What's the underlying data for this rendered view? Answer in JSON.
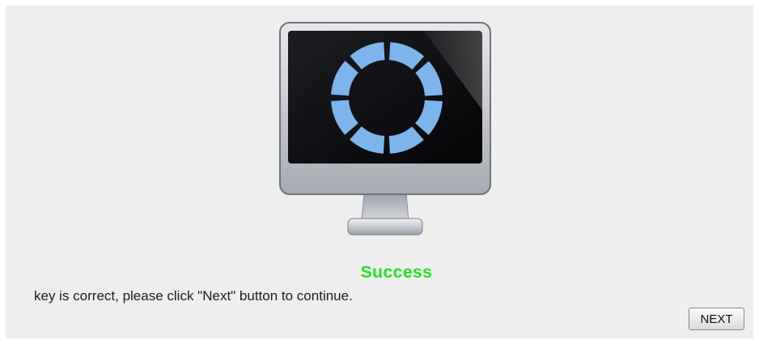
{
  "status": {
    "title": "Success",
    "message": "key is correct, please click \"Next\" button to continue."
  },
  "actions": {
    "next_label": "NEXT"
  },
  "illustration": {
    "icon": "monitor-loading-icon",
    "ring_color": "#7cb4ec"
  },
  "colors": {
    "success": "#22e322",
    "background": "#eeeeee"
  }
}
